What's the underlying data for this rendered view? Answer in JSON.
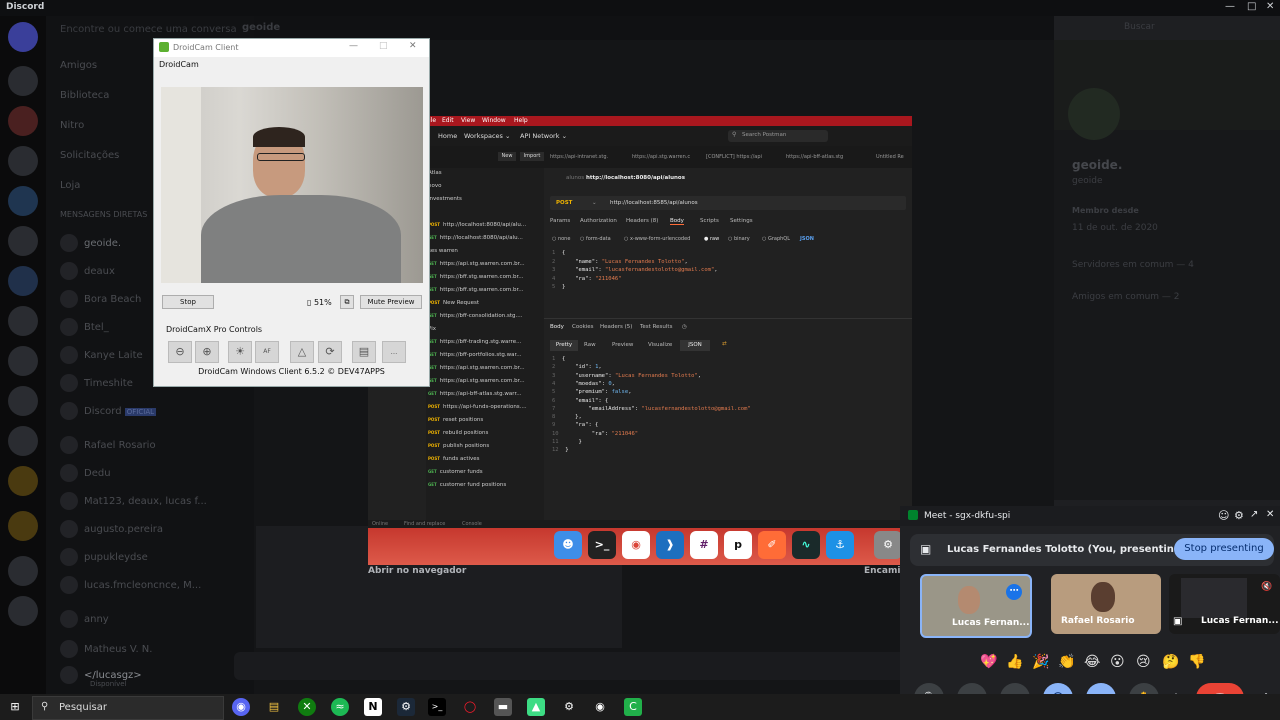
{
  "discord": {
    "app_title": "Discord",
    "search_placeholder": "Buscar",
    "channel_header": "geoide",
    "channels": [
      "Amigos",
      "Biblioteca",
      "Nitro",
      "Solicitações",
      "Loja"
    ],
    "dm_header": "MENSAGENS DIRETAS",
    "dms": [
      "geoide.",
      "deaux",
      "Bora Beach",
      "Btel_",
      "Kanye Laite",
      "Timeshite",
      "Discord",
      "Rafael Rosario",
      "Dedu",
      "Mat123, deaux, lucas f...",
      "augusto.pereira",
      "pupukleydse",
      "lucas.fmcleoncnce, M...",
      "anny",
      "Matheus V. N."
    ],
    "discord_official_badge": "OFICIAL",
    "user_name": "</lucasgz>",
    "user_status": "Disponível",
    "profile_name": "geoide.",
    "profile_tag": "geoide",
    "member_since_label": "Membro desde",
    "member_since_value": "11 de out. de 2020",
    "mutual_servers": "Servidores em comum — 4",
    "mutual_friends": "Amigos em comum — 2"
  },
  "droidcam": {
    "window_title": "DroidCam Client",
    "app_label": "DroidCam",
    "stop_label": "Stop",
    "battery_text": "51%",
    "mute_preview_label": "Mute Preview",
    "pro_controls_label": "DroidCamX Pro Controls",
    "footer": "DroidCam Windows Client 6.5.2 © DEV47APPS"
  },
  "postman": {
    "menu": [
      "File",
      "Edit",
      "View",
      "Window",
      "Help"
    ],
    "nav": [
      "Home",
      "Workspaces",
      "API Network"
    ],
    "search_placeholder": "Search Postman",
    "new_label": "New",
    "import_label": "Import",
    "tabs": [
      "https://api-intranet.stg.",
      "https://api.stg.warren.c",
      "[CONFLICT] https://api",
      "https://api-bff-atlas.stg",
      "Untitled Re"
    ],
    "breadcrumb_parent": "alunos",
    "breadcrumb_url": "http://localhost:8080/api/alunos",
    "method": "POST",
    "url": "http://localhost:8585/api/alunos",
    "req_tabs": [
      "Params",
      "Authorization",
      "Headers (8)",
      "Body",
      "Scripts",
      "Settings"
    ],
    "body_types": [
      "none",
      "form-data",
      "x-www-form-urlencoded",
      "raw",
      "binary",
      "GraphQL"
    ],
    "body_format": "JSON",
    "request_lines": [
      [
        "1",
        "{"
      ],
      [
        "2",
        "    \"name\": \"Lucas Fernandes Tolotto\","
      ],
      [
        "3",
        "    \"email\": \"lucasfernandestolotto@gmail.com\","
      ],
      [
        "4",
        "    \"ra\": \"211046\""
      ],
      [
        "5",
        "}"
      ]
    ],
    "resp_tabs": [
      "Body",
      "Cookies",
      "Headers (5)",
      "Test Results"
    ],
    "resp_views": [
      "Pretty",
      "Raw",
      "Preview",
      "Visualize"
    ],
    "resp_format": "JSON",
    "response_lines": [
      [
        "1",
        "{"
      ],
      [
        "2",
        "    \"id\": 1,"
      ],
      [
        "3",
        "    \"username\": \"Lucas Fernandes Tolotto\","
      ],
      [
        "4",
        "    \"moedas\": 0,"
      ],
      [
        "5",
        "    \"premium\": false,"
      ],
      [
        "6",
        "    \"email\": {"
      ],
      [
        "7",
        "        \"emailAddress\": \"lucasfernandestolotto@gmail.com\""
      ],
      [
        "8",
        "    },"
      ],
      [
        "9",
        "    \"ra\": {"
      ],
      [
        "10",
        "        \"ra\": \"211046\""
      ],
      [
        "11",
        "    }"
      ],
      [
        "12",
        "}"
      ]
    ],
    "sidebar_items": [
      [
        "",
        "Atlas"
      ],
      [
        "",
        "novo"
      ],
      [
        "",
        "investments"
      ],
      [
        "",
        ""
      ],
      [
        "POST",
        "http://localhost:8080/api/alu..."
      ],
      [
        "GET",
        "http://localhost:8080/api/alu..."
      ],
      [
        "",
        "ses warren"
      ],
      [
        "GET",
        "https://api.stg.warren.com.br..."
      ],
      [
        "GET",
        "https://bff.stg.warren.com.br..."
      ],
      [
        "GET",
        "https://bff.stg.warren.com.br..."
      ],
      [
        "POST",
        "New Request"
      ],
      [
        "GET",
        "https://bff-consolidation.stg...."
      ],
      [
        "",
        "Pix"
      ],
      [
        "GET",
        "https://bff-trading.stg.warre..."
      ],
      [
        "GET",
        "https://bff-portfolios.stg.war..."
      ],
      [
        "GET",
        "https://api.stg.warren.com.br..."
      ],
      [
        "GET",
        "https://api.stg.warren.com.br..."
      ],
      [
        "GET",
        "https://api-bff-atlas.stg.warr..."
      ],
      [
        "POST",
        "https://api-funds-operations...."
      ],
      [
        "POST",
        "reset positions"
      ],
      [
        "POST",
        "rebuild positions"
      ],
      [
        "POST",
        "publish positions"
      ],
      [
        "POST",
        "funds actives"
      ],
      [
        "GET",
        "customer funds"
      ],
      [
        "GET",
        "customer fund positions"
      ]
    ],
    "footer": [
      "Online",
      "Find and replace",
      "Console"
    ]
  },
  "browser_strip": {
    "left_text": "Abrir no navegador",
    "right_text": "Encamin"
  },
  "meet": {
    "title": "Meet - sgx-dkfu-spi",
    "presenting_text": "Lucas Fernandes Tolotto (You, presenting)",
    "stop_presenting_label": "Stop presenting",
    "participants": [
      "Lucas Fernan...",
      "Rafael Rosario",
      "Lucas Fernan..."
    ],
    "reactions": [
      "💖",
      "👍",
      "🎉",
      "👏",
      "😂",
      "😮",
      "😢",
      "🤔",
      "👎"
    ]
  },
  "taskbar": {
    "search_placeholder": "Pesquisar"
  },
  "colors": {
    "postman_red": "#a9171e",
    "meet_blue": "#8ab4f8",
    "end_call_red": "#ea4335",
    "discord_bg": "#1e1f22"
  }
}
